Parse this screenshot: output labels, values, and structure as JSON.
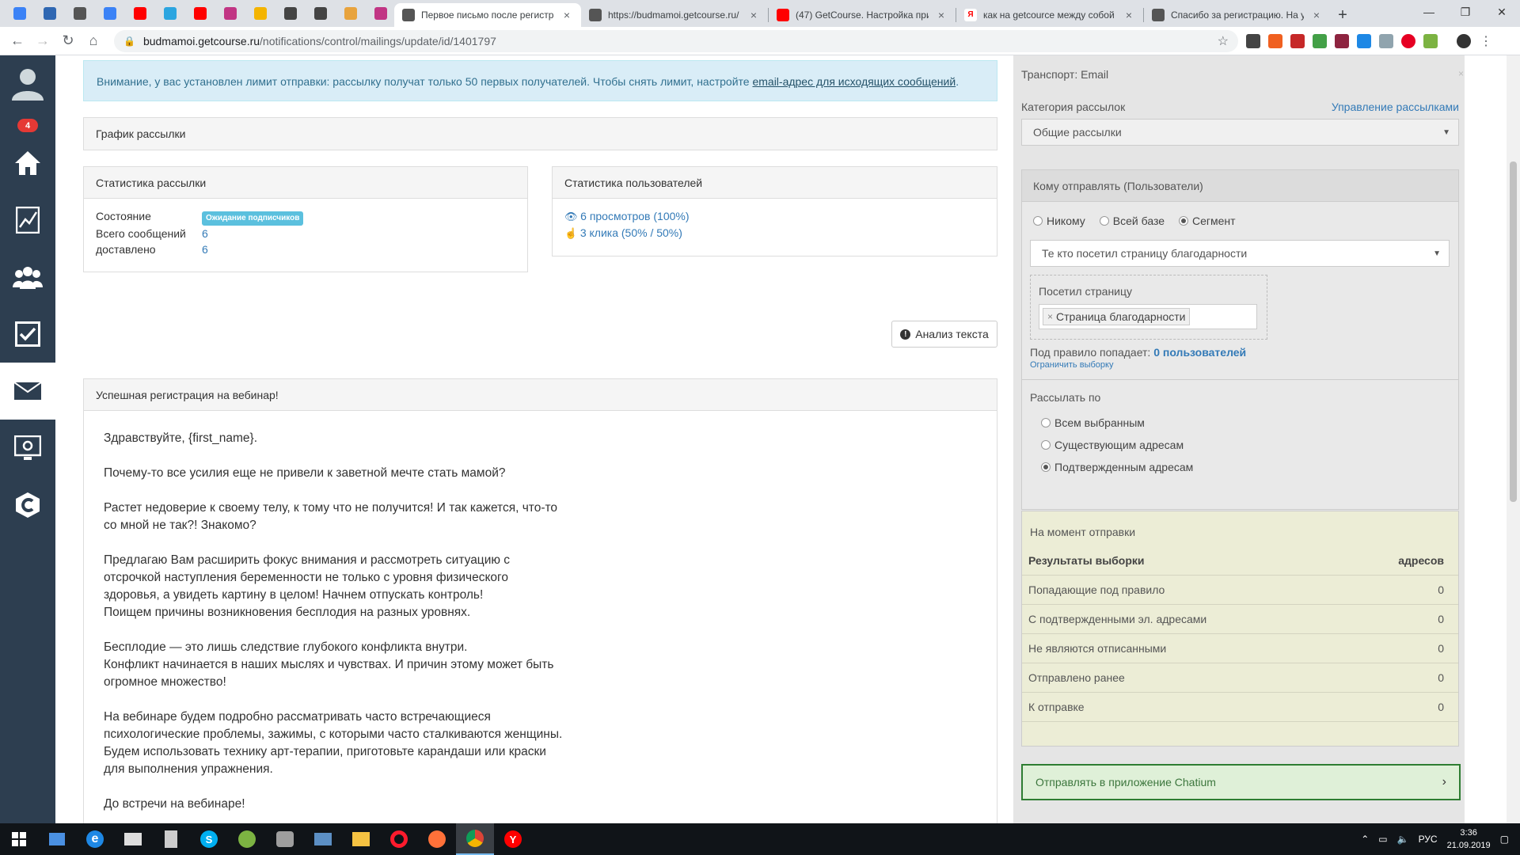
{
  "browser": {
    "pinned_tabs": [
      {
        "icon": "getcourse-icon",
        "color": "#3b82f6"
      },
      {
        "icon": "chat-icon",
        "color": "#2f67b2"
      },
      {
        "icon": "calendar-icon",
        "color": "#555555"
      },
      {
        "icon": "getcourse-icon",
        "color": "#3b82f6"
      },
      {
        "icon": "youtube-icon",
        "color": "#ff0000"
      },
      {
        "icon": "telegram-icon",
        "color": "#2ca5e0"
      },
      {
        "icon": "youtube-icon",
        "color": "#ff0000"
      },
      {
        "icon": "instagram-icon",
        "color": "#c13584"
      },
      {
        "icon": "analytics-icon",
        "color": "#f4b400"
      },
      {
        "icon": "getcourse-icon",
        "color": "#444444"
      },
      {
        "icon": "getcourse-icon",
        "color": "#444444"
      },
      {
        "icon": "mail-icon",
        "color": "#e8a33d"
      },
      {
        "icon": "instagram-icon",
        "color": "#c13584"
      }
    ],
    "tabs": [
      {
        "title": "Первое письмо после регистра",
        "icon": "getcourse-icon",
        "active": true
      },
      {
        "title": "https://budmamoi.getcourse.ru/",
        "icon": "getcourse-icon",
        "active": false
      },
      {
        "title": "(47) GetCourse. Настройка при",
        "icon": "youtube-icon",
        "active": false
      },
      {
        "title": "как на getcource между собой",
        "icon": "yandex-icon",
        "active": false
      },
      {
        "title": "Спасибо за регистрацию. На у",
        "icon": "getcourse-icon",
        "active": false
      }
    ],
    "url_host": "budmamoi.getcourse.ru",
    "url_path": "/notifications/control/mailings/update/id/1401797"
  },
  "sidebar": {
    "badge": "4",
    "items": [
      "avatar",
      "home-icon",
      "chart-icon",
      "users-icon",
      "tasks-icon",
      "mail-icon",
      "settings-icon",
      "getcourse-logo-icon"
    ]
  },
  "alert": {
    "text": "Внимание, у вас установлен лимит отправки: рассылку получат только 50 первых получателей. Чтобы снять лимит, настройте ",
    "link": "email-адрес для исходящих сообщений",
    "suffix": "."
  },
  "schedule": {
    "title": "График рассылки"
  },
  "mailing_stats": {
    "title": "Статистика рассылки",
    "state_label": "Состояние",
    "state_value": "Ожидание подписчиков",
    "total_label": "Всего сообщений",
    "total_value": "6",
    "delivered_label": "доставлено",
    "delivered_value": "6"
  },
  "user_stats": {
    "title": "Статистика пользователей",
    "views": "6 просмотров (100%)",
    "clicks": "3 клика (50% / 50%)"
  },
  "analysis_button": "Анализ текста",
  "letter": {
    "subject": "Успешная регистрация на вебинар!",
    "paragraphs": [
      "Здравствуйте, {first_name}.",
      "Почему-то все усилия еще не привели к заветной мечте стать мамой?",
      "Растет недоверие к своему телу, к тому что не получится! И так кажется, что-то\nсо мной не так?! Знакомо?",
      "Предлагаю Вам расширить фокус внимания и рассмотреть ситуацию с\nотсрочкой наступления беременности не только с уровня физического\nздоровья, а увидеть картину в целом! Начнем отпускать контроль!\nПоищем причины возникновения бесплодия на разных уровнях.",
      "Бесплодие — это лишь следствие глубокого конфликта внутри.\nКонфликт начинается в наших мыслях и чувствах. И причин этому может быть\nогромное множество!",
      "На вебинаре будем подробно рассматривать часто встречающиеся\nпсихологические проблемы, зажимы, с которыми часто сталкиваются женщины.\nБудем использовать технику арт-терапии, приготовьте карандаши или краски\nдля выполнения упражнения.",
      "До встречи на вебинаре!"
    ]
  },
  "right": {
    "transport": "Транспорт: Email",
    "category_label": "Категория рассылок",
    "manage_link": "Управление рассылками",
    "category_value": "Общие рассылки",
    "recipients_title": "Кому отправлять (Пользователи)",
    "recipient_options": [
      {
        "label": "Никому",
        "checked": false
      },
      {
        "label": "Всей базе",
        "checked": false
      },
      {
        "label": "Сегмент",
        "checked": true
      }
    ],
    "segment_value": "Те кто посетил страницу благодарности",
    "condition_label": "Посетил страницу",
    "condition_tag": "Страница благодарности",
    "rule_text": "Под правило попадает:",
    "rule_count": "0 пользователей",
    "limit_link": "Ограничить выборку",
    "send_by_label": "Рассылать по",
    "send_by_options": [
      {
        "label": "Всем выбранным",
        "checked": false
      },
      {
        "label": "Существующим адресам",
        "checked": false
      },
      {
        "label": "Подтвержденным адресам",
        "checked": true
      }
    ],
    "moment_label": "На момент отправки",
    "results_header": "Результаты выборки",
    "results_unit": "адресов",
    "results_rows": [
      {
        "label": "Попадающие под правило",
        "value": "0"
      },
      {
        "label": "С подтвержденными эл. адресами",
        "value": "0"
      },
      {
        "label": "Не являются отписанными",
        "value": "0"
      },
      {
        "label": "Отправлено ранее",
        "value": "0"
      },
      {
        "label": "К отправке",
        "value": "0"
      }
    ],
    "chatium": "Отправлять в приложение Chatium"
  },
  "taskbar": {
    "lang": "РУС",
    "time": "3:36",
    "date": "21.09.2019"
  }
}
